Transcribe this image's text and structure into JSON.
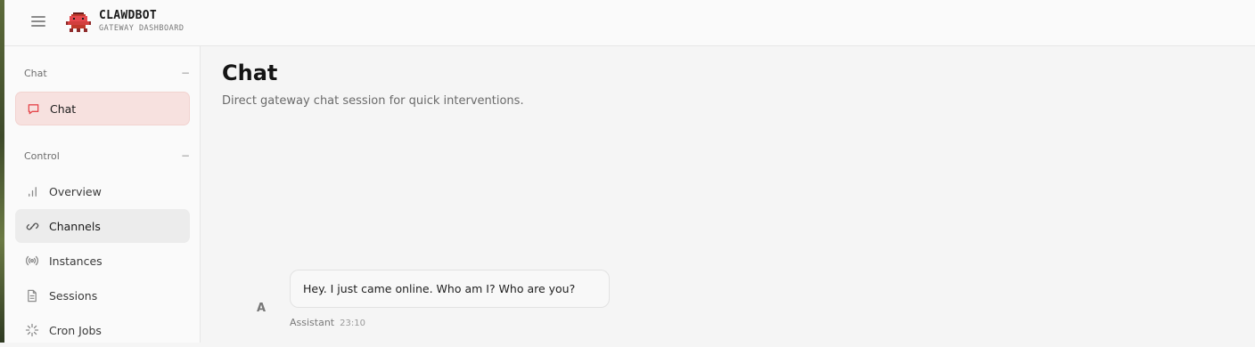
{
  "app": {
    "title": "CLAWDBOT",
    "subtitle": "GATEWAY DASHBOARD",
    "accent": "#e5484d"
  },
  "sidebar": {
    "sections": [
      {
        "label": "Chat",
        "collapse_glyph": "−"
      },
      {
        "label": "Control",
        "collapse_glyph": "−"
      }
    ],
    "items": [
      {
        "label": "Chat",
        "icon": "message-square-icon",
        "state": "active"
      },
      {
        "label": "Overview",
        "icon": "bar-chart-icon"
      },
      {
        "label": "Channels",
        "icon": "link-icon",
        "state": "hover"
      },
      {
        "label": "Instances",
        "icon": "radio-broadcast-icon"
      },
      {
        "label": "Sessions",
        "icon": "file-icon"
      },
      {
        "label": "Cron Jobs",
        "icon": "loader-icon"
      }
    ]
  },
  "main": {
    "title": "Chat",
    "subtitle": "Direct gateway chat session for quick interventions."
  },
  "messages": [
    {
      "avatar": "A",
      "text": "Hey. I just came online. Who am I? Who are you?",
      "sender": "Assistant",
      "time": "23:10"
    }
  ]
}
